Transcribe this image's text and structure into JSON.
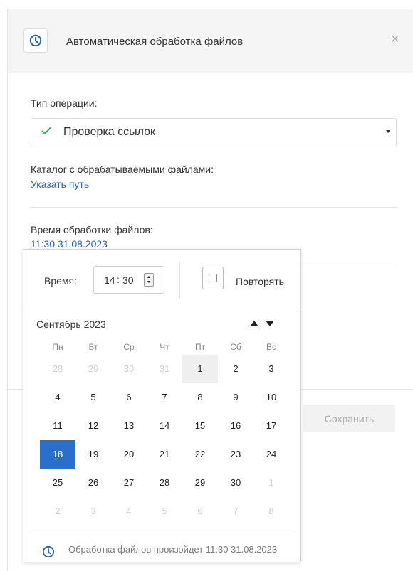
{
  "dialog": {
    "title": "Автоматическая обработка файлов",
    "close": "×",
    "icon": "clock-icon"
  },
  "form": {
    "operation_label": "Тип операции:",
    "operation_value": "Проверка ссылок",
    "folder_label": "Каталог с обрабатываемыми файлами:",
    "folder_link": "Указать путь",
    "time_label": "Время обработки файлов:",
    "time_link": "11:30 31.08.2023"
  },
  "save_label": "Сохранить",
  "picker": {
    "time_label": "Время:",
    "hours": "14",
    "minutes": "30",
    "separator": ":",
    "repeat_label": "Повторять",
    "repeat_checked": false,
    "month_title": "Сентябрь  2023",
    "weekdays": [
      "Пн",
      "Вт",
      "Ср",
      "Чт",
      "Пт",
      "Сб",
      "Вс"
    ],
    "weeks": [
      [
        {
          "d": "28",
          "m": true
        },
        {
          "d": "29",
          "m": true
        },
        {
          "d": "30",
          "m": true
        },
        {
          "d": "31",
          "m": true
        },
        {
          "d": "1",
          "today": true
        },
        {
          "d": "2"
        },
        {
          "d": "3"
        }
      ],
      [
        {
          "d": "4"
        },
        {
          "d": "5"
        },
        {
          "d": "6"
        },
        {
          "d": "7"
        },
        {
          "d": "8"
        },
        {
          "d": "9"
        },
        {
          "d": "10"
        }
      ],
      [
        {
          "d": "11"
        },
        {
          "d": "12"
        },
        {
          "d": "13"
        },
        {
          "d": "14"
        },
        {
          "d": "15"
        },
        {
          "d": "16"
        },
        {
          "d": "17"
        }
      ],
      [
        {
          "d": "18",
          "selected": true
        },
        {
          "d": "19"
        },
        {
          "d": "20"
        },
        {
          "d": "21"
        },
        {
          "d": "22"
        },
        {
          "d": "23"
        },
        {
          "d": "24"
        }
      ],
      [
        {
          "d": "25"
        },
        {
          "d": "26"
        },
        {
          "d": "27"
        },
        {
          "d": "28"
        },
        {
          "d": "29"
        },
        {
          "d": "30"
        },
        {
          "d": "1",
          "m": true
        }
      ],
      [
        {
          "d": "2",
          "m": true
        },
        {
          "d": "3",
          "m": true
        },
        {
          "d": "4",
          "m": true
        },
        {
          "d": "5",
          "m": true
        },
        {
          "d": "6",
          "m": true
        },
        {
          "d": "7",
          "m": true
        },
        {
          "d": "8",
          "m": true
        }
      ]
    ],
    "footer_text": "Обработка файлов произойдет 11:30 31.08.2023"
  },
  "colors": {
    "accent": "#2a6fc9",
    "link": "#2a62b4",
    "check": "#3cab5a",
    "icon_blue": "#1f5fa8"
  }
}
